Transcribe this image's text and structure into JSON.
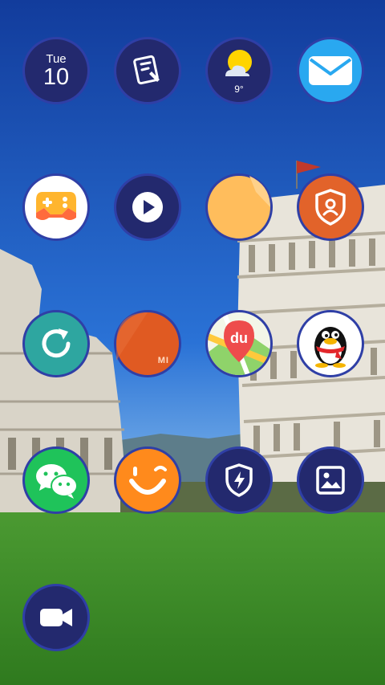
{
  "screen": {
    "name": "Home screen"
  },
  "icons": [
    {
      "id": "calendar",
      "type": "calendar",
      "day": "Tue",
      "date": "10",
      "icon": "calendar-icon"
    },
    {
      "id": "notes",
      "icon": "notes-icon"
    },
    {
      "id": "weather",
      "temperature": "9°",
      "icon": "weather-icon"
    },
    {
      "id": "mail",
      "icon": "mail-icon"
    },
    {
      "id": "game-center",
      "icon": "gamepad-icon"
    },
    {
      "id": "video-player",
      "icon": "play-icon"
    },
    {
      "id": "file-manager",
      "icon": "folder-icon"
    },
    {
      "id": "security",
      "icon": "shield-user-icon"
    },
    {
      "id": "updater",
      "icon": "refresh-icon"
    },
    {
      "id": "mi-store",
      "label": "MI",
      "icon": "mi-icon"
    },
    {
      "id": "baidu-maps",
      "label": "du",
      "icon": "baidu-maps-icon"
    },
    {
      "id": "qq",
      "icon": "qq-penguin-icon"
    },
    {
      "id": "wechat",
      "icon": "wechat-icon"
    },
    {
      "id": "face-app",
      "icon": "smiley-icon"
    },
    {
      "id": "cleaner",
      "icon": "shield-bolt-icon"
    },
    {
      "id": "gallery",
      "icon": "gallery-icon"
    },
    {
      "id": "screen-recorder",
      "icon": "video-camera-icon"
    }
  ],
  "colors": {
    "icon_navy": "#23296e",
    "sky": "#1f5fc4",
    "grass": "#3d8f2a"
  }
}
